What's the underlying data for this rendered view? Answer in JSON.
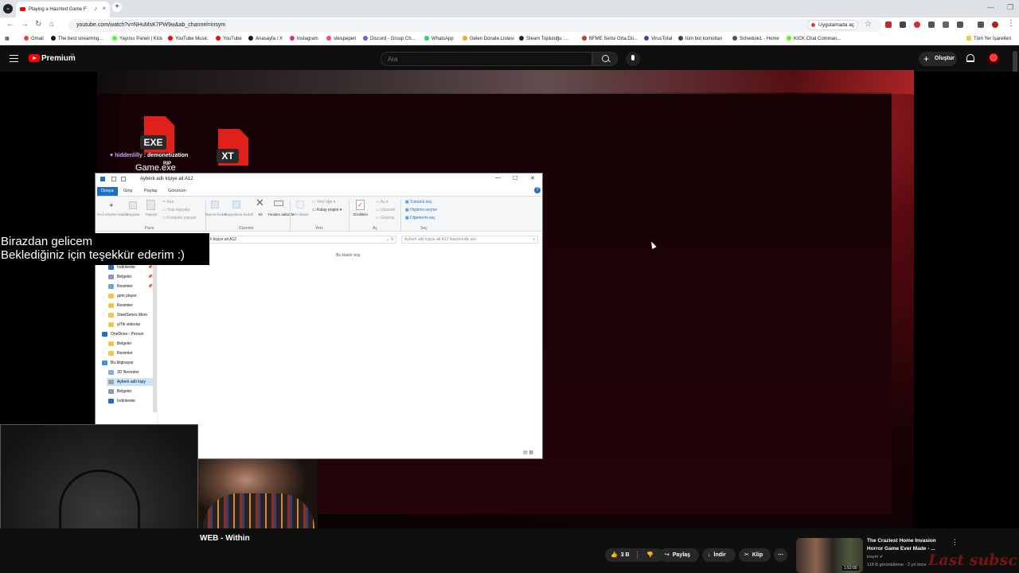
{
  "browser": {
    "tab_title": "Playing a Haunted Game F",
    "url": "youtube.com/watch?v=NHuMsK7PW9w&ab_channel=insym",
    "app_chip": "Uygulamada aç",
    "bookmarks": [
      {
        "label": "Gmail",
        "color": "#ea4335"
      },
      {
        "label": "The best streaming...",
        "color": "#111111"
      },
      {
        "label": "Yayıncı Paneli | Kick",
        "color": "#53fc18"
      },
      {
        "label": "YouTube Music",
        "color": "#ff0000"
      },
      {
        "label": "YouTube",
        "color": "#ff0000"
      },
      {
        "label": "Anasayfa / X",
        "color": "#111111"
      },
      {
        "label": "Instagram",
        "color": "#e1306c"
      },
      {
        "label": "sikispeperi",
        "color": "#ff4081"
      },
      {
        "label": "Discord - Group Ch...",
        "color": "#5865f2"
      },
      {
        "label": "WhatsApp",
        "color": "#25d366"
      },
      {
        "label": "Gelen Donate Listesi",
        "color": "#f5a623"
      },
      {
        "label": "Steam Topluluğu :...",
        "color": "#1b2838"
      },
      {
        "label": "BFME Serisi Orta Dü...",
        "color": "#c0392b"
      },
      {
        "label": "VirusTotal",
        "color": "#3949ab"
      },
      {
        "label": "tüm bot komutları",
        "color": "#444444"
      },
      {
        "label": "Schedule1 - Home",
        "color": "#6d4c41"
      },
      {
        "label": "KICK Chat Comman...",
        "color": "#53fc18"
      }
    ],
    "all_bookmarks": "Tüm Yer İşaretleri"
  },
  "youtube": {
    "brand": "Premium",
    "country": "TR",
    "search_placeholder": "Ara",
    "create_label": "Oluştur"
  },
  "stream_overlay": {
    "exe_label": "EXE",
    "txt_label": "XT",
    "chat_user": "hiddenlilly",
    "chat_text": "demonetization",
    "game_label": "Game.exe",
    "rip": "RIP",
    "caption_line1": "Birazdan gelicem",
    "caption_line2": "Beklediğiniz için teşekkür ederim :)"
  },
  "explorer": {
    "title": "Ayberk adlı kişiye ait A12",
    "tabs": [
      "Dosya",
      "Giriş",
      "Paylaş",
      "Görünüm"
    ],
    "ribbon": {
      "pin": "Hızlı erişime sabitle",
      "copy": "Kopyala",
      "paste": "Yapıştır",
      "cut": "Kes",
      "copy_path": "Yolu kopyala",
      "paste_shortcut": "Kısayolu yapıştır",
      "group_clipboard": "Pano",
      "move": "Taşıma hedefi",
      "copy_to": "Kopyalama hedefi",
      "delete": "Sil",
      "rename": "Yeniden adlandır",
      "new_folder": "Yeni klasör",
      "group_organize": "Düzenle",
      "new_item": "Yeni öğe",
      "easy_access": "Kolay erişim",
      "group_new": "Yeni",
      "properties": "Özellikler",
      "open": "Aç",
      "edit": "Düzenle",
      "history": "Geçmiş",
      "group_open": "Aç",
      "select_all": "Tümünü seç",
      "select_none": "Hiçbirini seçme",
      "invert": "Diğerlerini seç",
      "group_select": "Seç"
    },
    "address": "lı kişiye ait A12",
    "search_placeholder": "Ayberk adlı kişiye ait A12 klasöründe ara",
    "empty_text": "Bu klasör boş.",
    "nav_items": [
      {
        "label": "İndirilenler",
        "color": "#1f6fc5",
        "pinned": true,
        "sel": false,
        "top": false
      },
      {
        "label": "Belgeler",
        "color": "#8a9bb0",
        "pinned": true,
        "sel": false,
        "top": false
      },
      {
        "label": "Resimler",
        "color": "#6aa5d8",
        "pinned": true,
        "sel": false,
        "top": false
      },
      {
        "label": "gom player",
        "color": "#f2c94c",
        "pinned": false,
        "sel": false,
        "top": false
      },
      {
        "label": "Resimler",
        "color": "#f2c94c",
        "pinned": false,
        "sel": false,
        "top": false
      },
      {
        "label": "SteelSeries Mom",
        "color": "#f2c94c",
        "pinned": false,
        "sel": false,
        "top": false
      },
      {
        "label": "ytTik videolar",
        "color": "#f2c94c",
        "pinned": false,
        "sel": false,
        "top": false
      },
      {
        "label": "OneDrive - Person",
        "color": "#1f6fc5",
        "pinned": false,
        "sel": false,
        "top": true
      },
      {
        "label": "Belgeler",
        "color": "#f2c94c",
        "pinned": false,
        "sel": false,
        "top": false
      },
      {
        "label": "Resimler",
        "color": "#f2c94c",
        "pinned": false,
        "sel": false,
        "top": false
      },
      {
        "label": "Bu bilgisayar",
        "color": "#4a90d9",
        "pinned": false,
        "sel": false,
        "top": true
      },
      {
        "label": "3D Nesneler",
        "color": "#7fb2e5",
        "pinned": false,
        "sel": false,
        "top": false
      },
      {
        "label": "Ayberk adlı kişiy",
        "color": "#9aa4ad",
        "pinned": false,
        "sel": true,
        "top": false
      },
      {
        "label": "Belgeler",
        "color": "#8a9bb0",
        "pinned": false,
        "sel": false,
        "top": false
      },
      {
        "label": "İndirilenler",
        "color": "#1f6fc5",
        "pinned": false,
        "sel": false,
        "top": false
      }
    ]
  },
  "video": {
    "title": "WEB - Within",
    "likes": "3 B",
    "share": "Paylaş",
    "download": "İndir",
    "clip": "Klip"
  },
  "recommended": {
    "title": "The Craziest Home Invasion Horror Game Ever Made - ...",
    "channel": "insym",
    "meta": "118 B görüntüleme · 2 yıl önce",
    "duration": "1:52:00",
    "watermark": "Last subsc"
  }
}
